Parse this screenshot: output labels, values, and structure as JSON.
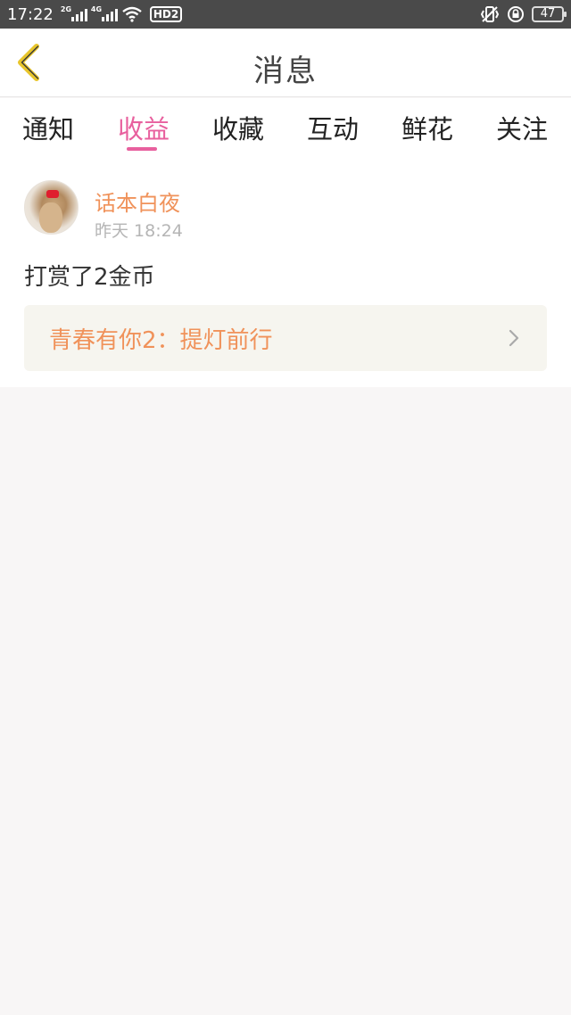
{
  "status_bar": {
    "time": "17:22",
    "sim1_tag": "2G",
    "sim2_tag": "4G",
    "hd_badge": "HD2",
    "battery": "47"
  },
  "header": {
    "title": "消息",
    "back_icon": "chevron-left-icon"
  },
  "tabs": [
    {
      "label": "通知",
      "active": false
    },
    {
      "label": "收益",
      "active": true
    },
    {
      "label": "收藏",
      "active": false
    },
    {
      "label": "互动",
      "active": false
    },
    {
      "label": "鲜花",
      "active": false
    },
    {
      "label": "关注",
      "active": false
    }
  ],
  "message": {
    "username": "话本白夜",
    "time": "昨天 18:24",
    "text": "打赏了2金币",
    "link_title": "青春有你2：提灯前行"
  },
  "colors": {
    "accent": "#e8609e",
    "orange": "#f0925a",
    "back_icon": "#e8c52a"
  }
}
